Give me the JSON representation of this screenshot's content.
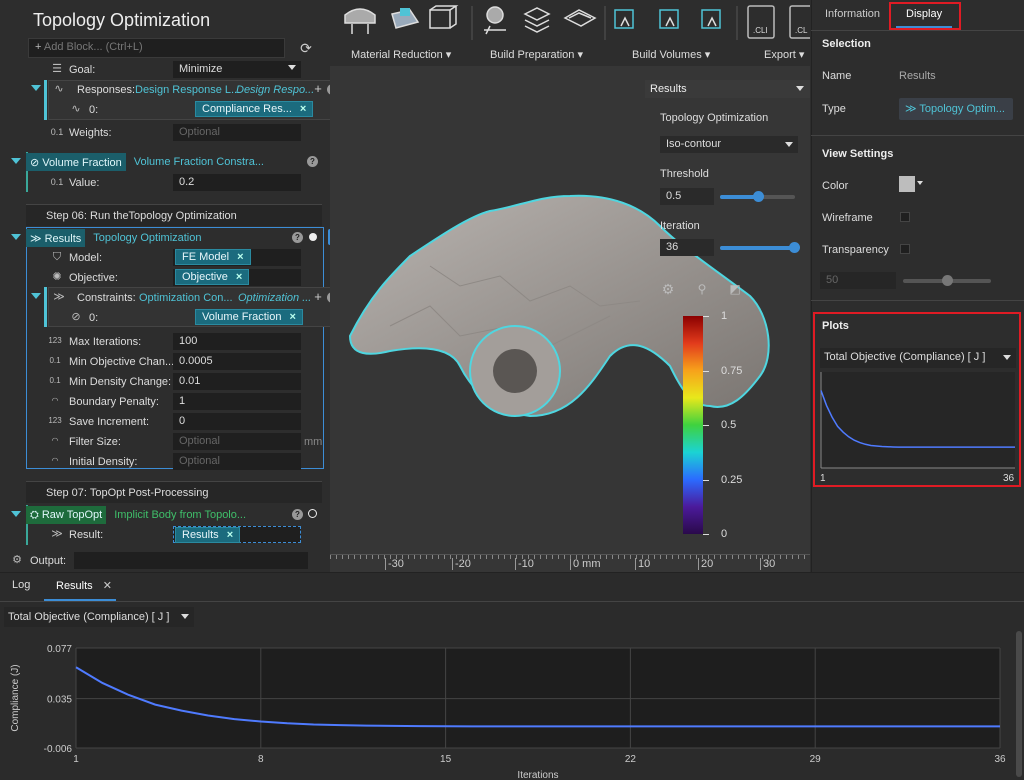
{
  "app": {
    "title": "Topology Optimization",
    "add_block_placeholder": "Add Block... (Ctrl+L)"
  },
  "tree": {
    "goal": {
      "label": "Goal:",
      "value": "Minimize"
    },
    "responses": {
      "label": "Responses:",
      "type": "Design Response L...",
      "name": "Design Respo...",
      "item_index": "0:",
      "item_value": "Compliance Res..."
    },
    "weights": {
      "label": "Weights:",
      "placeholder": "Optional"
    },
    "volume_fraction": {
      "tag": "Volume Fraction",
      "name": "Volume Fraction Constra...",
      "value_label": "Value:",
      "value": "0.2"
    },
    "step06": {
      "title": "Step 06: Run theTopology Optimization"
    },
    "results_block": {
      "tag": "Results",
      "name": "Topology Optimization"
    },
    "model": {
      "label": "Model:",
      "value": "FE Model"
    },
    "objective": {
      "label": "Objective:",
      "value": "Objective"
    },
    "constraints": {
      "label": "Constraints:",
      "type": "Optimization Con...",
      "name": "Optimization ...",
      "item_index": "0:",
      "item_value": "Volume Fraction"
    },
    "params": [
      {
        "label": "Max Iterations:",
        "value": "100"
      },
      {
        "label": "Min Objective Chan...",
        "value": "0.0005"
      },
      {
        "label": "Min Density Change:",
        "value": "0.01"
      },
      {
        "label": "Boundary Penalty:",
        "value": "1"
      },
      {
        "label": "Save Increment:",
        "value": "0"
      },
      {
        "label": "Filter Size:",
        "value": "Optional",
        "unit": "mm"
      },
      {
        "label": "Initial Density:",
        "value": "Optional"
      }
    ],
    "step07": {
      "title": "Step 07: TopOpt Post-Processing"
    },
    "raw_topopt": {
      "tag": "Raw TopOpt",
      "name": "Implicit Body from Topolo...",
      "result_label": "Result:",
      "result_value": "Results"
    },
    "output_label": "Output:"
  },
  "toolbar": {
    "groups": [
      {
        "label": "Material Reduction"
      },
      {
        "label": "Build Preparation"
      },
      {
        "label": "Build Volumes"
      },
      {
        "label": "Export"
      }
    ],
    "cli1": ".CLI",
    "cli2": ".CL"
  },
  "results_pane": {
    "title": "Results",
    "subtitle": "Topology Optimization",
    "mode": "Iso-contour",
    "threshold_label": "Threshold",
    "threshold_value": "0.5",
    "threshold_fraction": 0.5,
    "iteration_label": "Iteration",
    "iteration_value": "36",
    "iteration_fraction": 1.0,
    "legend_ticks": [
      "1",
      "0.75",
      "0.5",
      "0.25",
      "0"
    ]
  },
  "ruler": {
    "ticks": [
      "-30",
      "-20",
      "-10",
      "0 mm",
      "10",
      "20",
      "30"
    ]
  },
  "right_panel": {
    "tabs": [
      "Information",
      "Display"
    ],
    "active_tab": "Display",
    "selection_title": "Selection",
    "name_label": "Name",
    "name_value": "Results",
    "type_label": "Type",
    "type_value": "Topology Optim...",
    "view_settings_title": "View Settings",
    "color_label": "Color",
    "color_value": "#bdbdbd",
    "wireframe_label": "Wireframe",
    "transparency_label": "Transparency",
    "transparency_value": "50",
    "transparency_fraction": 0.5,
    "plots_title": "Plots",
    "plot_select": "Total Objective (Compliance) [ J ]",
    "plot_xmin": "1",
    "plot_xmax": "36"
  },
  "bottom": {
    "tabs": [
      "Log",
      "Results"
    ],
    "active_tab": "Results",
    "plot_select": "Total Objective (Compliance) [ J ]"
  },
  "chart_data": {
    "type": "line",
    "title": "",
    "xlabel": "Iterations",
    "ylabel": "Compliance (J)",
    "xlim": [
      1,
      36
    ],
    "ylim": [
      -0.006,
      0.077
    ],
    "xticks": [
      1,
      8,
      15,
      22,
      29,
      36
    ],
    "yticks": [
      0.077,
      0.035,
      -0.006
    ],
    "ytick_labels": [
      "0.077",
      "0.035",
      "-0.006"
    ],
    "grid": true,
    "series": [
      {
        "color": "#4f7bff",
        "x": [
          1,
          2,
          3,
          4,
          5,
          6,
          7,
          8,
          9,
          10,
          11,
          12,
          13,
          14,
          15,
          16,
          17,
          18,
          19,
          20,
          21,
          22,
          23,
          24,
          25,
          26,
          27,
          28,
          29,
          30,
          31,
          32,
          33,
          34,
          35,
          36
        ],
        "y": [
          0.061,
          0.048,
          0.038,
          0.03,
          0.025,
          0.021,
          0.018,
          0.016,
          0.0145,
          0.0135,
          0.013,
          0.0126,
          0.0124,
          0.0122,
          0.0121,
          0.012,
          0.012,
          0.012,
          0.012,
          0.012,
          0.012,
          0.012,
          0.012,
          0.012,
          0.012,
          0.012,
          0.012,
          0.012,
          0.012,
          0.012,
          0.012,
          0.012,
          0.012,
          0.012,
          0.012,
          0.012
        ]
      }
    ]
  }
}
